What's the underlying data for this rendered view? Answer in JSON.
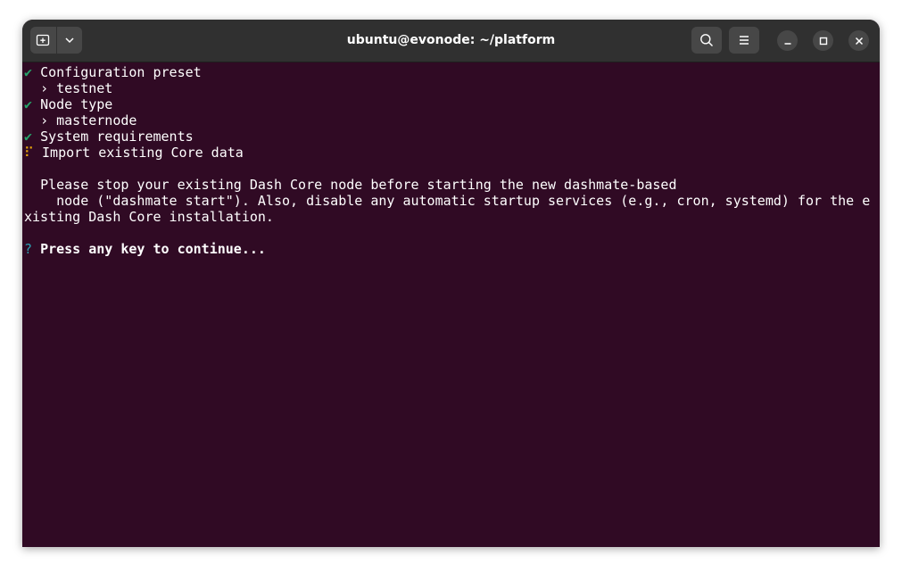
{
  "window": {
    "title": "ubuntu@evonode: ~/platform"
  },
  "icons": {
    "new_tab": "new-tab-icon",
    "dropdown": "chevron-down-icon",
    "search": "search-icon",
    "menu": "hamburger-menu-icon",
    "minimize": "minimize-icon",
    "maximize": "maximize-icon",
    "close": "close-icon"
  },
  "terminal": {
    "lines": [
      {
        "prefix": "✔",
        "text": "Configuration preset"
      },
      {
        "prefix": " ",
        "text": "› testnet"
      },
      {
        "prefix": "✔",
        "text": "Node type"
      },
      {
        "prefix": " ",
        "text": "› masternode"
      },
      {
        "prefix": "✔",
        "text": "System requirements"
      },
      {
        "prefix": "⠏",
        "text": "Import existing Core data"
      },
      {
        "prefix": " ",
        "text": ""
      },
      {
        "prefix": " ",
        "text": "Please stop your existing Dash Core node before starting the new dashmate-based"
      },
      {
        "prefix": " ",
        "text": "  node (\"dashmate start\"). Also, disable any automatic startup services (e.g., cron, systemd) for the e"
      },
      {
        "prefix": "",
        "text": "xisting Dash Core installation."
      },
      {
        "prefix": "",
        "text": ""
      },
      {
        "prefix": "?",
        "text": "Press any key to continue..."
      }
    ]
  },
  "colors": {
    "terminal_bg": "#300a24",
    "titlebar_bg": "#303030",
    "check_green": "#26a269",
    "spinner_yellow": "#e5a50a",
    "prompt_cyan": "#2aa1b3"
  }
}
